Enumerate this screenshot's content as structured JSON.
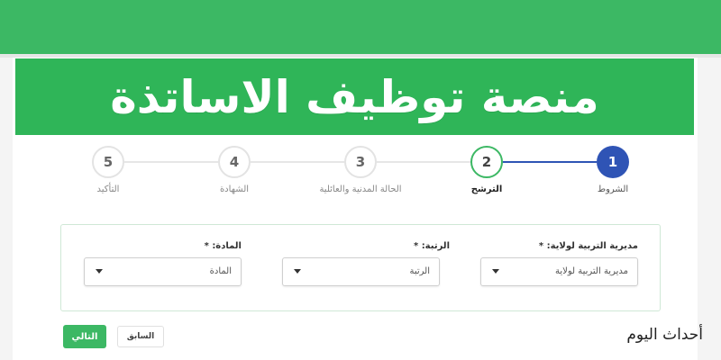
{
  "banner": {
    "title": "منصة توظيف الاساتذة"
  },
  "stepper": {
    "steps": [
      {
        "number": "1",
        "label": "الشروط",
        "state": "completed"
      },
      {
        "number": "2",
        "label": "الترشح",
        "state": "active"
      },
      {
        "number": "3",
        "label": "الحالة المدنية والعائلية",
        "state": "pending"
      },
      {
        "number": "4",
        "label": "الشهادة",
        "state": "pending"
      },
      {
        "number": "5",
        "label": "التأكيد",
        "state": "pending"
      }
    ]
  },
  "form": {
    "fields": [
      {
        "label": "مديرية التربية لولاية:",
        "required_mark": "*",
        "value": "مديرية التربية لولاية"
      },
      {
        "label": "الرتبة:",
        "required_mark": "*",
        "value": "الرتبة"
      },
      {
        "label": "المادة:",
        "required_mark": "*",
        "value": "المادة"
      }
    ]
  },
  "buttons": {
    "next_label": "التالي",
    "previous_label": "السابق"
  },
  "watermark": {
    "text": "أحداث اليوم"
  },
  "colors": {
    "header_green": "#3cb864",
    "banner_green": "#2fb558",
    "step_completed": "#2f54b5",
    "step_active_border": "#3cb864",
    "step_pending_border": "#e3e3e3"
  }
}
